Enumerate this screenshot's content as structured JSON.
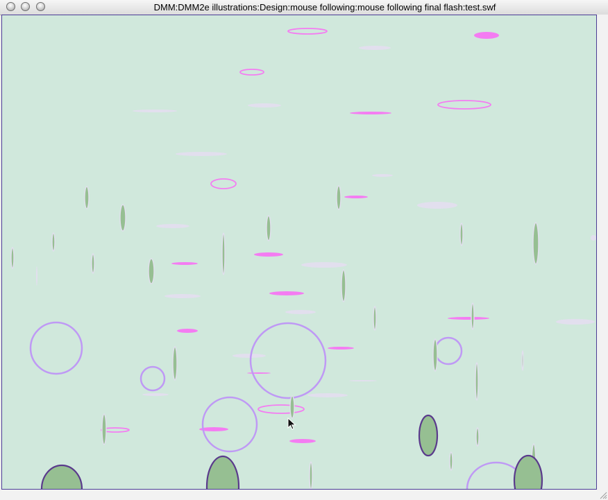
{
  "window": {
    "title": "DMM:DMM2e illustrations:Design:mouse following:mouse following final flash:test.swf",
    "buttons": [
      {
        "name": "close-button"
      },
      {
        "name": "minimize-button"
      },
      {
        "name": "zoom-button"
      }
    ]
  },
  "stage": {
    "background": "#d0e8dc",
    "colors": {
      "pink": "#f47cf2",
      "lavender": "#e2dfee",
      "violet": "#bf99f5",
      "green": "#96bf92",
      "dark_outline": "#5a3a8c"
    }
  },
  "cursor": {
    "icon": "arrow-pointer-icon"
  }
}
